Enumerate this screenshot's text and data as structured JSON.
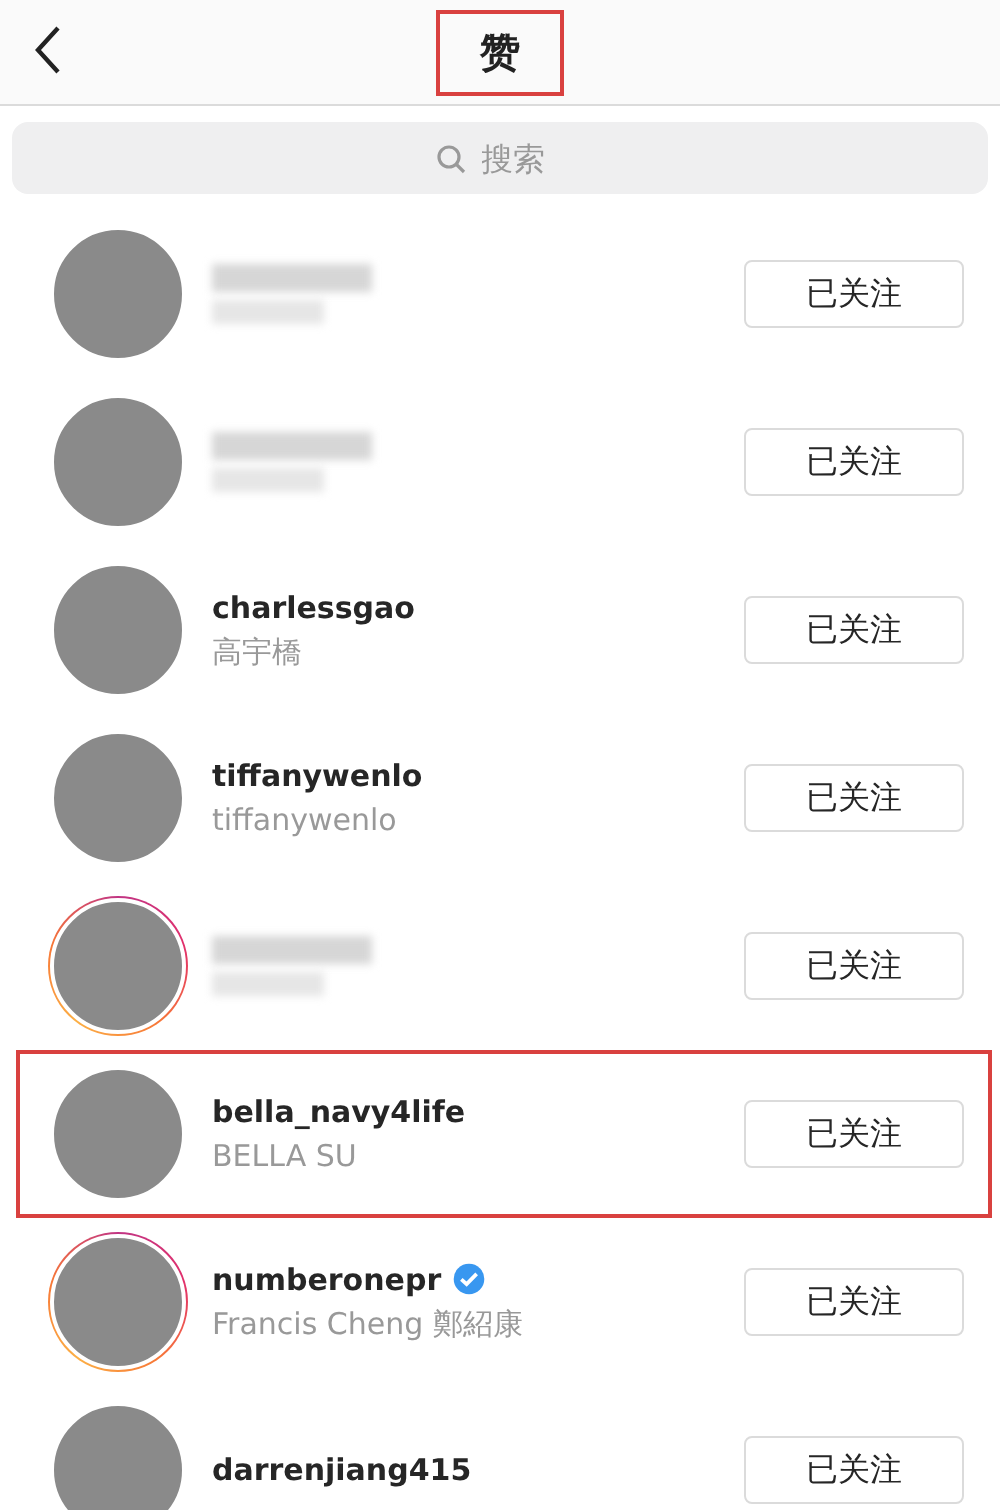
{
  "header": {
    "title": "赞",
    "title_highlighted": true
  },
  "search": {
    "placeholder": "搜索"
  },
  "users": [
    {
      "username_blurred": true,
      "story_ring": false,
      "highlighted": false,
      "button": "已关注"
    },
    {
      "username_blurred": true,
      "story_ring": false,
      "highlighted": false,
      "button": "已关注"
    },
    {
      "username": "charlessgao",
      "full_name": "高宇橋",
      "username_blurred": false,
      "story_ring": false,
      "verified": false,
      "highlighted": false,
      "button": "已关注"
    },
    {
      "username": "tiffanywenlo",
      "full_name": "tiffanywenlo",
      "username_blurred": false,
      "story_ring": false,
      "verified": false,
      "highlighted": false,
      "button": "已关注"
    },
    {
      "username_blurred": true,
      "story_ring": true,
      "highlighted": false,
      "button": "已关注"
    },
    {
      "username": "bella_navy4life",
      "full_name": "BELLA SU",
      "username_blurred": false,
      "story_ring": false,
      "verified": false,
      "highlighted": true,
      "button": "已关注"
    },
    {
      "username": "numberonepr",
      "full_name": "Francis Cheng 鄭紹康",
      "username_blurred": false,
      "story_ring": true,
      "verified": true,
      "highlighted": false,
      "button": "已关注"
    },
    {
      "username": "darrenjiang415",
      "username_blurred": false,
      "story_ring": false,
      "verified": false,
      "highlighted": false,
      "button": "已关注"
    }
  ]
}
